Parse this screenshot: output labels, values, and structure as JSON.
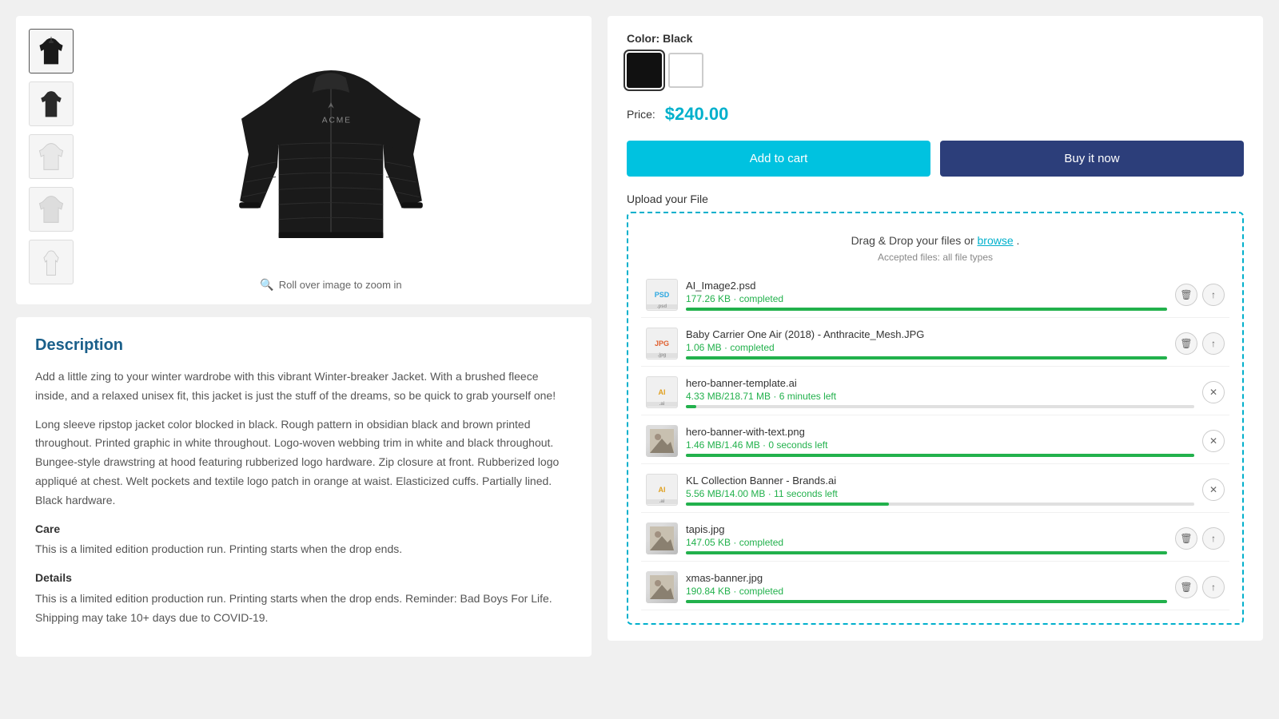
{
  "product": {
    "color_label": "Color:",
    "color_value": "Black",
    "price_label": "Price:",
    "price": "$240.00",
    "btn_add_cart": "Add to cart",
    "btn_buy_now": "Buy it now",
    "zoom_hint": "Roll over image to zoom in",
    "upload_label": "Upload your File",
    "dropzone_text": "Drag & Drop your files or",
    "dropzone_browse": "browse",
    "dropzone_period": ".",
    "dropzone_accepted": "Accepted files: all file types"
  },
  "description": {
    "title": "Description",
    "para1": "Add a little zing to your winter wardrobe with this vibrant Winter-breaker Jacket. With a brushed fleece inside, and a relaxed unisex fit, this jacket is just the stuff of the dreams, so be quick to grab yourself one!",
    "para2": "Long sleeve ripstop jacket color blocked in black. Rough pattern in obsidian black and brown printed throughout. Printed graphic in white throughout. Logo-woven webbing trim in white and black throughout. Bungee-style drawstring at hood featuring rubberized logo hardware. Zip closure at front. Rubberized logo appliqué at chest. Welt pockets and textile logo patch in orange at waist. Elasticized cuffs. Partially lined. Black hardware.",
    "care_label": "Care",
    "care_text": "This is a limited edition production run. Printing starts when the drop ends.",
    "details_label": "Details",
    "details_text": "This is a limited edition production run. Printing starts when the drop ends. Reminder: Bad Boys For Life. Shipping may take 10+ days due to COVID-19."
  },
  "colors": [
    {
      "name": "Black",
      "class": "black",
      "active": true
    },
    {
      "name": "White",
      "class": "white",
      "active": false
    }
  ],
  "files": [
    {
      "name": "AI_Image2.psd",
      "status": "177.26 KB · completed",
      "progress": 100,
      "type": "psd",
      "actions": [
        "delete",
        "upload"
      ],
      "thumbnail": "psd"
    },
    {
      "name": "Baby Carrier One Air (2018) - Anthracite_Mesh.JPG",
      "status": "1.06 MB · completed",
      "progress": 100,
      "type": "jpg",
      "actions": [
        "delete",
        "upload"
      ],
      "thumbnail": "jpg"
    },
    {
      "name": "hero-banner-template.ai",
      "status": "4.33 MB/218.71 MB · 6 minutes left",
      "progress": 2,
      "type": "ai",
      "actions": [
        "close"
      ],
      "thumbnail": "ai"
    },
    {
      "name": "hero-banner-with-text.png",
      "status": "1.46 MB/1.46 MB · 0 seconds left",
      "progress": 100,
      "type": "png",
      "actions": [
        "close"
      ],
      "thumbnail": "img"
    },
    {
      "name": "KL Collection Banner - Brands.ai",
      "status": "5.56 MB/14.00 MB · 11 seconds left",
      "progress": 40,
      "type": "ai",
      "actions": [
        "close"
      ],
      "thumbnail": "ai"
    },
    {
      "name": "tapis.jpg",
      "status": "147.05 KB · completed",
      "progress": 100,
      "type": "jpg",
      "actions": [
        "delete",
        "upload"
      ],
      "thumbnail": "img"
    },
    {
      "name": "xmas-banner.jpg",
      "status": "190.84 KB · completed",
      "progress": 100,
      "type": "jpg",
      "actions": [
        "delete",
        "upload"
      ],
      "thumbnail": "img"
    }
  ]
}
